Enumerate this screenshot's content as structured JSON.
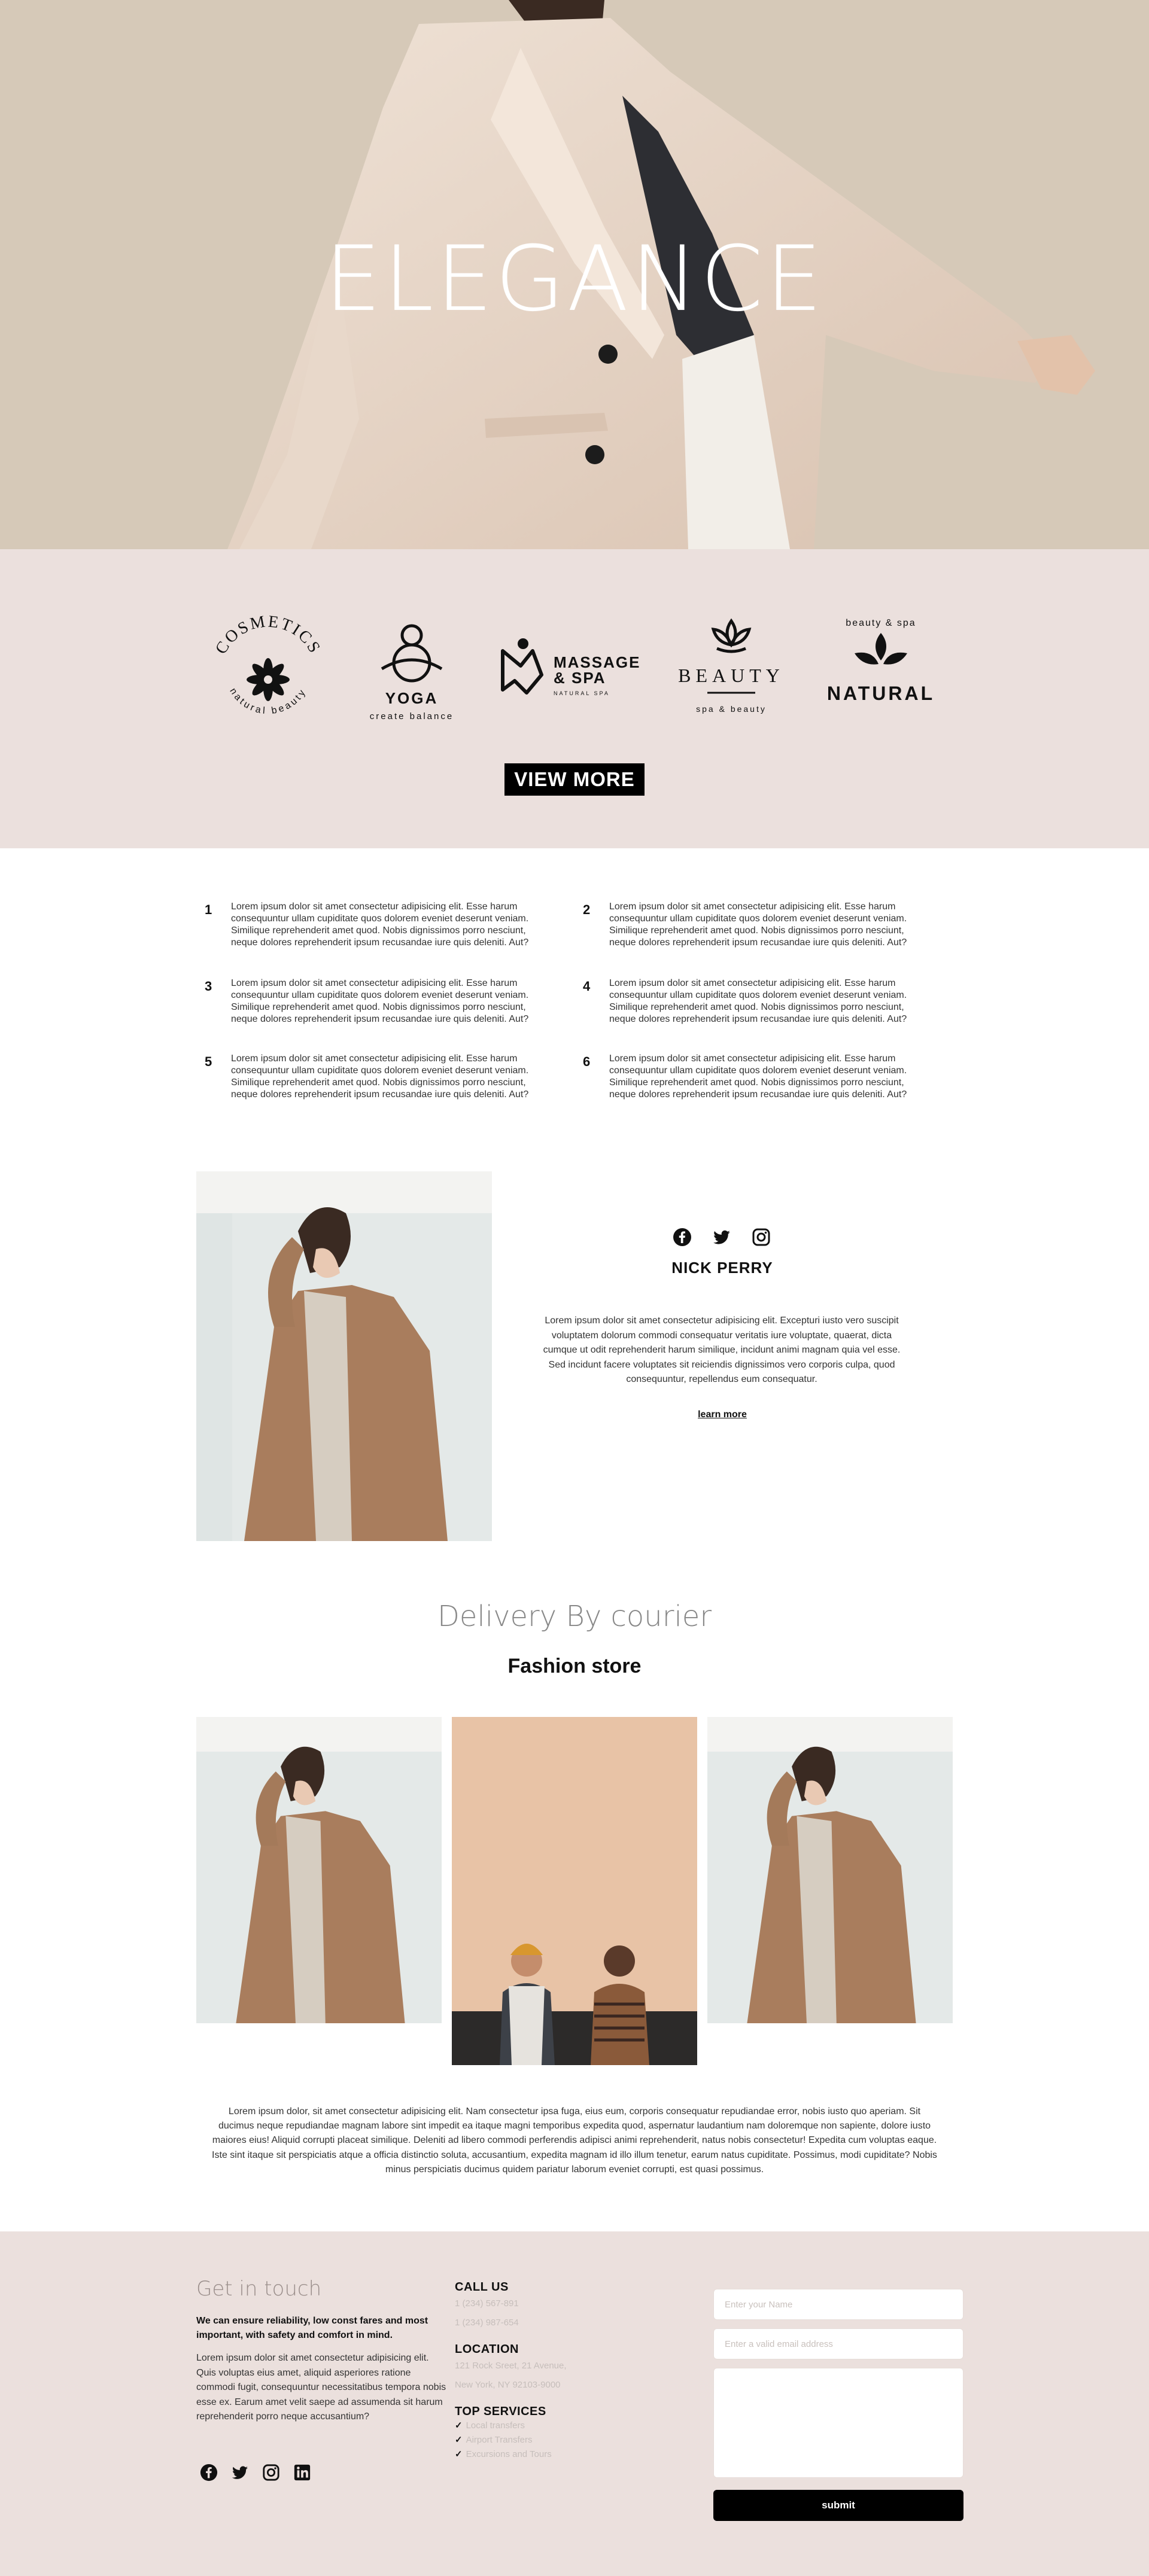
{
  "hero": {
    "title": "ELEGANCE"
  },
  "logos": {
    "items": [
      {
        "name": "cosmetics",
        "top": "COSMETICS",
        "bottom": "natural beauty"
      },
      {
        "name": "yoga",
        "main": "YOGA",
        "sub": "create balance"
      },
      {
        "name": "massage-spa",
        "main": "MASSAGE",
        "main2": "& SPA",
        "sub": "NATURAL SPA"
      },
      {
        "name": "beauty",
        "main": "BEAUTY",
        "sub": "spa & beauty"
      },
      {
        "name": "natural",
        "top": "beauty & spa",
        "main": "NATURAL"
      }
    ],
    "view_more": "VIEW MORE"
  },
  "features": [
    {
      "num": "1",
      "text": "Lorem ipsum dolor sit amet consectetur adipisicing elit. Esse harum consequuntur ullam cupiditate quos dolorem eveniet deserunt veniam. Similique reprehenderit amet quod. Nobis dignissimos porro nesciunt, neque dolores reprehenderit ipsum recusandae iure quis deleniti. Aut?"
    },
    {
      "num": "2",
      "text": "Lorem ipsum dolor sit amet consectetur adipisicing elit. Esse harum consequuntur ullam cupiditate quos dolorem eveniet deserunt veniam. Similique reprehenderit amet quod. Nobis dignissimos porro nesciunt, neque dolores reprehenderit ipsum recusandae iure quis deleniti. Aut?"
    },
    {
      "num": "3",
      "text": "Lorem ipsum dolor sit amet consectetur adipisicing elit. Esse harum consequuntur ullam cupiditate quos dolorem eveniet deserunt veniam. Similique reprehenderit amet quod. Nobis dignissimos porro nesciunt, neque dolores reprehenderit ipsum recusandae iure quis deleniti. Aut?"
    },
    {
      "num": "4",
      "text": "Lorem ipsum dolor sit amet consectetur adipisicing elit. Esse harum consequuntur ullam cupiditate quos dolorem eveniet deserunt veniam. Similique reprehenderit amet quod. Nobis dignissimos porro nesciunt, neque dolores reprehenderit ipsum recusandae iure quis deleniti. Aut?"
    },
    {
      "num": "5",
      "text": "Lorem ipsum dolor sit amet consectetur adipisicing elit. Esse harum consequuntur ullam cupiditate quos dolorem eveniet deserunt veniam. Similique reprehenderit amet quod. Nobis dignissimos porro nesciunt, neque dolores reprehenderit ipsum recusandae iure quis deleniti. Aut?"
    },
    {
      "num": "6",
      "text": "Lorem ipsum dolor sit amet consectetur adipisicing elit. Esse harum consequuntur ullam cupiditate quos dolorem eveniet deserunt veniam. Similique reprehenderit amet quod. Nobis dignissimos porro nesciunt, neque dolores reprehenderit ipsum recusandae iure quis deleniti. Aut?"
    }
  ],
  "profile": {
    "socials": [
      "facebook-icon",
      "twitter-icon",
      "instagram-icon"
    ],
    "name": "NICK PERRY",
    "bio": "Lorem ipsum dolor sit amet consectetur adipisicing elit. Excepturi iusto vero suscipit voluptatem dolorum commodi consequatur veritatis iure voluptate, quaerat, dicta cumque ut odit reprehenderit harum similique, incidunt animi magnam quia vel esse. Sed incidunt facere voluptates sit reiciendis dignissimos vero corporis culpa, quod consequuntur, repellendus eum consequatur.",
    "learn_more": "learn more"
  },
  "delivery": {
    "title": "Delivery By courier",
    "subtitle": "Fashion store",
    "text": "Lorem ipsum dolor, sit amet consectetur adipisicing elit. Nam consectetur ipsa fuga, eius eum, corporis consequatur repudiandae error, nobis iusto quo aperiam. Sit ducimus neque repudiandae magnam labore sint impedit ea itaque magni temporibus expedita quod, aspernatur laudantium nam doloremque non sapiente, dolore iusto maiores eius! Aliquid corrupti placeat similique. Deleniti ad libero commodi perferendis adipisci animi reprehenderit, natus nobis consectetur! Expedita cum voluptas eaque. Iste sint itaque sit perspiciatis atque a officia distinctio soluta, accusantium, expedita magnam id illo illum tenetur, earum natus cupiditate. Possimus, modi cupiditate? Nobis minus perspiciatis ducimus quidem pariatur laborum eveniet corrupti, est quasi possimus."
  },
  "footer": {
    "title": "Get in touch",
    "lead": "We can ensure reliability, low const fares and most important, with safety and comfort in mind.",
    "body": "Lorem ipsum dolor sit amet consectetur adipisicing elit. Quis voluptas eius amet, aliquid asperiores ratione commodi fugit, consequuntur necessitatibus tempora nobis esse ex. Earum amet velit saepe ad assumenda sit harum reprehenderit porro neque accusantium?",
    "socials": [
      "facebook-icon",
      "twitter-icon",
      "instagram-icon",
      "linkedin-icon"
    ],
    "call_us": {
      "heading": "CALL US",
      "lines": [
        "1 (234) 567-891",
        "1 (234) 987-654"
      ]
    },
    "location": {
      "heading": "LOCATION",
      "lines": [
        "121 Rock Sreet, 21 Avenue,",
        "New York, NY 92103-9000"
      ]
    },
    "services": {
      "heading": "TOP SERVICES",
      "items": [
        "Local transfers",
        "Airport Transfers",
        "Excursions and Tours"
      ]
    },
    "form": {
      "name_placeholder": "Enter your Name",
      "email_placeholder": "Enter a valid email address",
      "submit": "submit"
    }
  }
}
